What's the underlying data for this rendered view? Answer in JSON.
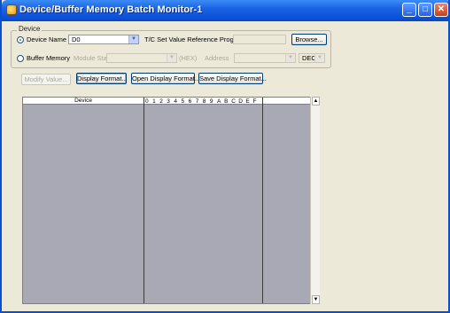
{
  "window": {
    "title": "Device/Buffer Memory Batch Monitor-1"
  },
  "device_group": {
    "title": "Device",
    "device_name_label": "Device Name",
    "device_name_value": "D0",
    "tc_label": "T/C Set Value Reference Program",
    "browse_label": "Browse...",
    "buffer_memory_label": "Buffer Memory",
    "module_start_label": "Module Start",
    "hex_label": "(HEX)",
    "address_label": "Address",
    "dec_value": "DEC"
  },
  "toolbar": {
    "modify_label": "Modify Value...",
    "display_format_label": "Display Format...",
    "open_format_label": "Open Display Format...",
    "save_format_label": "Save Display Format..."
  },
  "grid": {
    "device_header": "Device",
    "bits": [
      "0",
      "1",
      "2",
      "3",
      "4",
      "5",
      "6",
      "7",
      "8",
      "9",
      "A",
      "B",
      "C",
      "D",
      "E",
      "F"
    ]
  },
  "icons": {
    "app": "app-icon",
    "minimize": "minimize-icon",
    "maximize": "maximize-icon",
    "close": "close-icon",
    "dropdown": "chevron-down-icon",
    "scroll_up": "arrow-up-icon",
    "scroll_down": "arrow-down-icon"
  }
}
